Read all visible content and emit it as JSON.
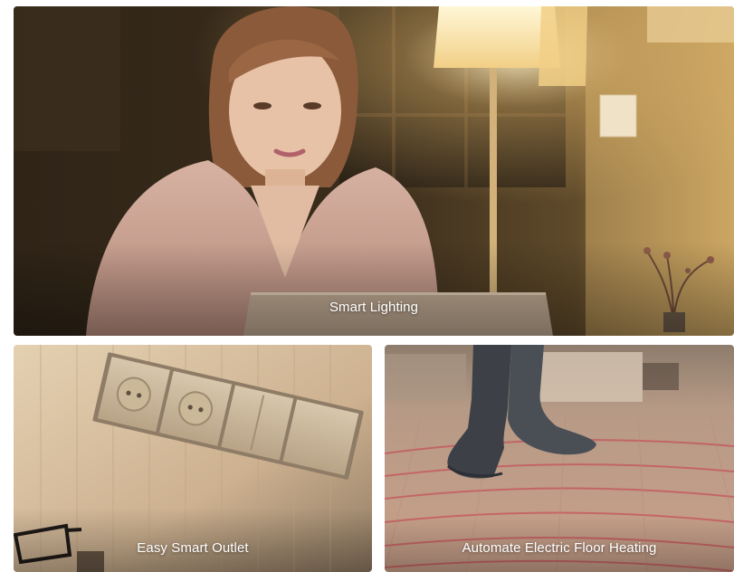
{
  "tiles": [
    {
      "caption": "Smart Lighting"
    },
    {
      "caption": "Easy Smart Outlet"
    },
    {
      "caption": "Automate Electric Floor Heating"
    }
  ],
  "colors": {
    "caption_text": "#ffffff",
    "lighting_bg": "#3a2c1c",
    "outlet_bg": "#d8c3a2",
    "floor_bg": "#b88e78"
  }
}
